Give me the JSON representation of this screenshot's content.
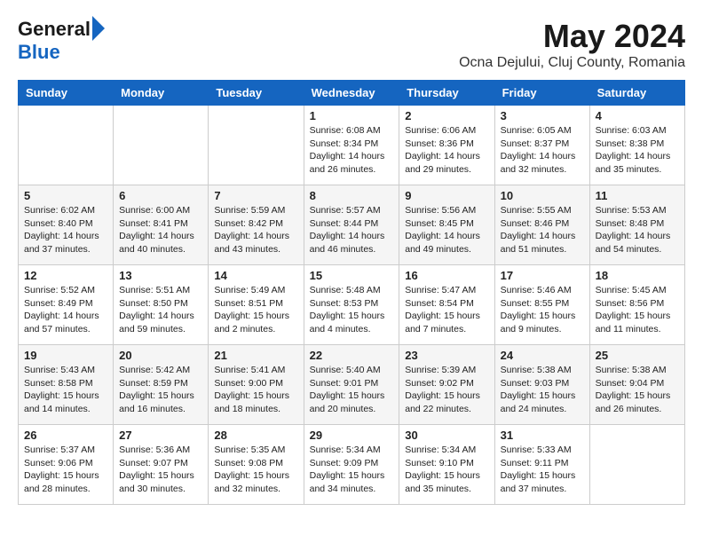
{
  "logo": {
    "general": "General",
    "blue": "Blue"
  },
  "title": "May 2024",
  "location": "Ocna Dejului, Cluj County, Romania",
  "days_of_week": [
    "Sunday",
    "Monday",
    "Tuesday",
    "Wednesday",
    "Thursday",
    "Friday",
    "Saturday"
  ],
  "weeks": [
    [
      {
        "day": "",
        "info": ""
      },
      {
        "day": "",
        "info": ""
      },
      {
        "day": "",
        "info": ""
      },
      {
        "day": "1",
        "info": "Sunrise: 6:08 AM\nSunset: 8:34 PM\nDaylight: 14 hours\nand 26 minutes."
      },
      {
        "day": "2",
        "info": "Sunrise: 6:06 AM\nSunset: 8:36 PM\nDaylight: 14 hours\nand 29 minutes."
      },
      {
        "day": "3",
        "info": "Sunrise: 6:05 AM\nSunset: 8:37 PM\nDaylight: 14 hours\nand 32 minutes."
      },
      {
        "day": "4",
        "info": "Sunrise: 6:03 AM\nSunset: 8:38 PM\nDaylight: 14 hours\nand 35 minutes."
      }
    ],
    [
      {
        "day": "5",
        "info": "Sunrise: 6:02 AM\nSunset: 8:40 PM\nDaylight: 14 hours\nand 37 minutes."
      },
      {
        "day": "6",
        "info": "Sunrise: 6:00 AM\nSunset: 8:41 PM\nDaylight: 14 hours\nand 40 minutes."
      },
      {
        "day": "7",
        "info": "Sunrise: 5:59 AM\nSunset: 8:42 PM\nDaylight: 14 hours\nand 43 minutes."
      },
      {
        "day": "8",
        "info": "Sunrise: 5:57 AM\nSunset: 8:44 PM\nDaylight: 14 hours\nand 46 minutes."
      },
      {
        "day": "9",
        "info": "Sunrise: 5:56 AM\nSunset: 8:45 PM\nDaylight: 14 hours\nand 49 minutes."
      },
      {
        "day": "10",
        "info": "Sunrise: 5:55 AM\nSunset: 8:46 PM\nDaylight: 14 hours\nand 51 minutes."
      },
      {
        "day": "11",
        "info": "Sunrise: 5:53 AM\nSunset: 8:48 PM\nDaylight: 14 hours\nand 54 minutes."
      }
    ],
    [
      {
        "day": "12",
        "info": "Sunrise: 5:52 AM\nSunset: 8:49 PM\nDaylight: 14 hours\nand 57 minutes."
      },
      {
        "day": "13",
        "info": "Sunrise: 5:51 AM\nSunset: 8:50 PM\nDaylight: 14 hours\nand 59 minutes."
      },
      {
        "day": "14",
        "info": "Sunrise: 5:49 AM\nSunset: 8:51 PM\nDaylight: 15 hours\nand 2 minutes."
      },
      {
        "day": "15",
        "info": "Sunrise: 5:48 AM\nSunset: 8:53 PM\nDaylight: 15 hours\nand 4 minutes."
      },
      {
        "day": "16",
        "info": "Sunrise: 5:47 AM\nSunset: 8:54 PM\nDaylight: 15 hours\nand 7 minutes."
      },
      {
        "day": "17",
        "info": "Sunrise: 5:46 AM\nSunset: 8:55 PM\nDaylight: 15 hours\nand 9 minutes."
      },
      {
        "day": "18",
        "info": "Sunrise: 5:45 AM\nSunset: 8:56 PM\nDaylight: 15 hours\nand 11 minutes."
      }
    ],
    [
      {
        "day": "19",
        "info": "Sunrise: 5:43 AM\nSunset: 8:58 PM\nDaylight: 15 hours\nand 14 minutes."
      },
      {
        "day": "20",
        "info": "Sunrise: 5:42 AM\nSunset: 8:59 PM\nDaylight: 15 hours\nand 16 minutes."
      },
      {
        "day": "21",
        "info": "Sunrise: 5:41 AM\nSunset: 9:00 PM\nDaylight: 15 hours\nand 18 minutes."
      },
      {
        "day": "22",
        "info": "Sunrise: 5:40 AM\nSunset: 9:01 PM\nDaylight: 15 hours\nand 20 minutes."
      },
      {
        "day": "23",
        "info": "Sunrise: 5:39 AM\nSunset: 9:02 PM\nDaylight: 15 hours\nand 22 minutes."
      },
      {
        "day": "24",
        "info": "Sunrise: 5:38 AM\nSunset: 9:03 PM\nDaylight: 15 hours\nand 24 minutes."
      },
      {
        "day": "25",
        "info": "Sunrise: 5:38 AM\nSunset: 9:04 PM\nDaylight: 15 hours\nand 26 minutes."
      }
    ],
    [
      {
        "day": "26",
        "info": "Sunrise: 5:37 AM\nSunset: 9:06 PM\nDaylight: 15 hours\nand 28 minutes."
      },
      {
        "day": "27",
        "info": "Sunrise: 5:36 AM\nSunset: 9:07 PM\nDaylight: 15 hours\nand 30 minutes."
      },
      {
        "day": "28",
        "info": "Sunrise: 5:35 AM\nSunset: 9:08 PM\nDaylight: 15 hours\nand 32 minutes."
      },
      {
        "day": "29",
        "info": "Sunrise: 5:34 AM\nSunset: 9:09 PM\nDaylight: 15 hours\nand 34 minutes."
      },
      {
        "day": "30",
        "info": "Sunrise: 5:34 AM\nSunset: 9:10 PM\nDaylight: 15 hours\nand 35 minutes."
      },
      {
        "day": "31",
        "info": "Sunrise: 5:33 AM\nSunset: 9:11 PM\nDaylight: 15 hours\nand 37 minutes."
      },
      {
        "day": "",
        "info": ""
      }
    ]
  ]
}
